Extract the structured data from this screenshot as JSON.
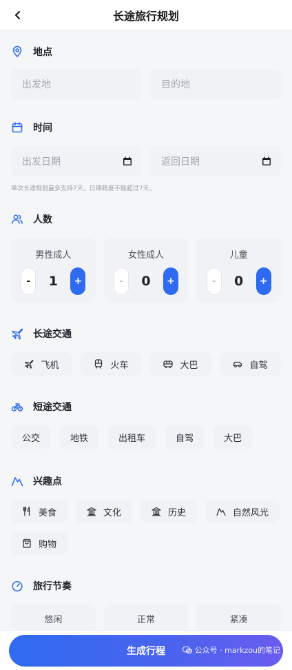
{
  "header": {
    "title": "长途旅行规划"
  },
  "sections": {
    "location": {
      "title": "地点",
      "origin_placeholder": "出发地",
      "destination_placeholder": "目的地"
    },
    "time": {
      "title": "时间",
      "depart_placeholder": "出发日期",
      "return_placeholder": "返回日期",
      "hint": "单次长途规划最多支持7天，日期跨度不能超过7天。"
    },
    "people": {
      "title": "人数",
      "counters": [
        {
          "label": "男性成人",
          "value": "1"
        },
        {
          "label": "女性成人",
          "value": "0"
        },
        {
          "label": "儿童",
          "value": "0"
        }
      ],
      "minus": "-",
      "plus": "+"
    },
    "long_transport": {
      "title": "长途交通",
      "options": [
        "飞机",
        "火车",
        "大巴",
        "自驾"
      ]
    },
    "short_transport": {
      "title": "短途交通",
      "options": [
        "公交",
        "地铁",
        "出租车",
        "自驾",
        "大巴"
      ]
    },
    "interests": {
      "title": "兴趣点",
      "options": [
        "美食",
        "文化",
        "历史",
        "自然风光",
        "购物"
      ]
    },
    "pace": {
      "title": "旅行节奏",
      "options": [
        "悠闲",
        "正常",
        "紧凑"
      ]
    }
  },
  "footer": {
    "generate_label": "生成行程",
    "watermark": "公众号 · markzou的笔记"
  },
  "colors": {
    "accent": "#2f6bf0",
    "background": "#f5f6f8"
  }
}
